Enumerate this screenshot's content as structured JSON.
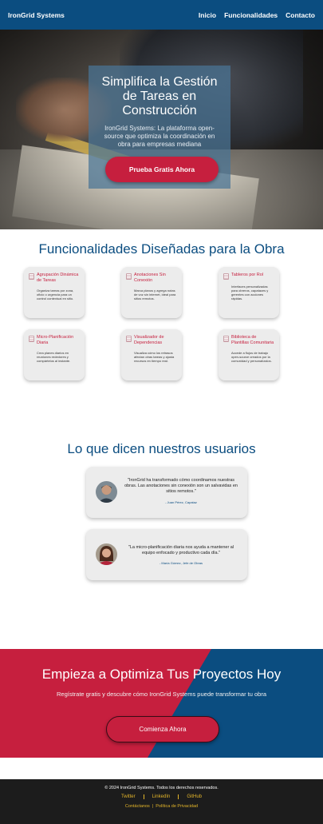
{
  "nav": {
    "brand": "IronGrid Systems",
    "links": [
      "Inicio",
      "Funcionalidades",
      "Contacto"
    ]
  },
  "hero": {
    "title": "Simplifica la Gestión de Tareas en Construcción",
    "subtitle": "IronGrid Systems: La plataforma open-source que optimiza la coordinación en obra para empresas mediana",
    "cta": "Prueba Gratis Ahora"
  },
  "features": {
    "title": "Funcionalidades Diseñadas para la Obra",
    "cards": [
      {
        "title": "Agrupación Dinámica de Tareas",
        "desc": "Organiza tareas por zona, oficio o urgencia para un control contextual en sitio."
      },
      {
        "title": "Anotaciones Sin Conexión",
        "desc": "Marca planos y agrega notas de voz sin internet, ideal para sitios remotos."
      },
      {
        "title": "Tableros por Rol",
        "desc": "Interfaces personalizadas para obreros, capataces y gerentes con acciones rápidas."
      },
      {
        "title": "Micro-Planificación Diaria",
        "desc": "Crea planes diarios en reuniones rededores y compártelos al instante."
      },
      {
        "title": "Visualizador de Dependencias",
        "desc": "Visualiza cómo los retrasos afectan otras tareas y ajusta recursos en tiempo real."
      },
      {
        "title": "Biblioteca de Plantillas Comunitaria",
        "desc": "Accede a flujos de trabajo open-source creados por la comunidad y personalízalos."
      }
    ]
  },
  "testimonials": {
    "title": "Lo que dicen nuestros usuarios",
    "items": [
      {
        "quote": "\"IronGrid ha transformado cómo coordinamos nuestras obras. Las anotaciones sin conexión son un salvavidas en sitios remotos.\"",
        "author": "- Juan Pérez, Capataz"
      },
      {
        "quote": "\"La micro-planificación diaria nos ayuda a mantener al equipo enfocado y productivo cada día.\"",
        "author": "- María Gómez, Jefe de Obras"
      }
    ]
  },
  "cta_band": {
    "title": "Empieza a Optimiza Tus Proyectos Hoy",
    "subtitle": "Regístrate gratis y descubre cómo IronGrid Systems puede transformar tu obra",
    "button": "Comienza Ahora",
    "colors": {
      "red": "#c61f3e",
      "blue": "#0b4d80"
    }
  },
  "footer": {
    "copyright": "© 2024 IronGrid Systems. Todos los derechos reservados.",
    "social": [
      "Twitter",
      "LinkedIn",
      "GitHub"
    ],
    "legal": [
      "Contáctanos",
      "Política de Privacidad"
    ],
    "legal_sep": "|"
  }
}
